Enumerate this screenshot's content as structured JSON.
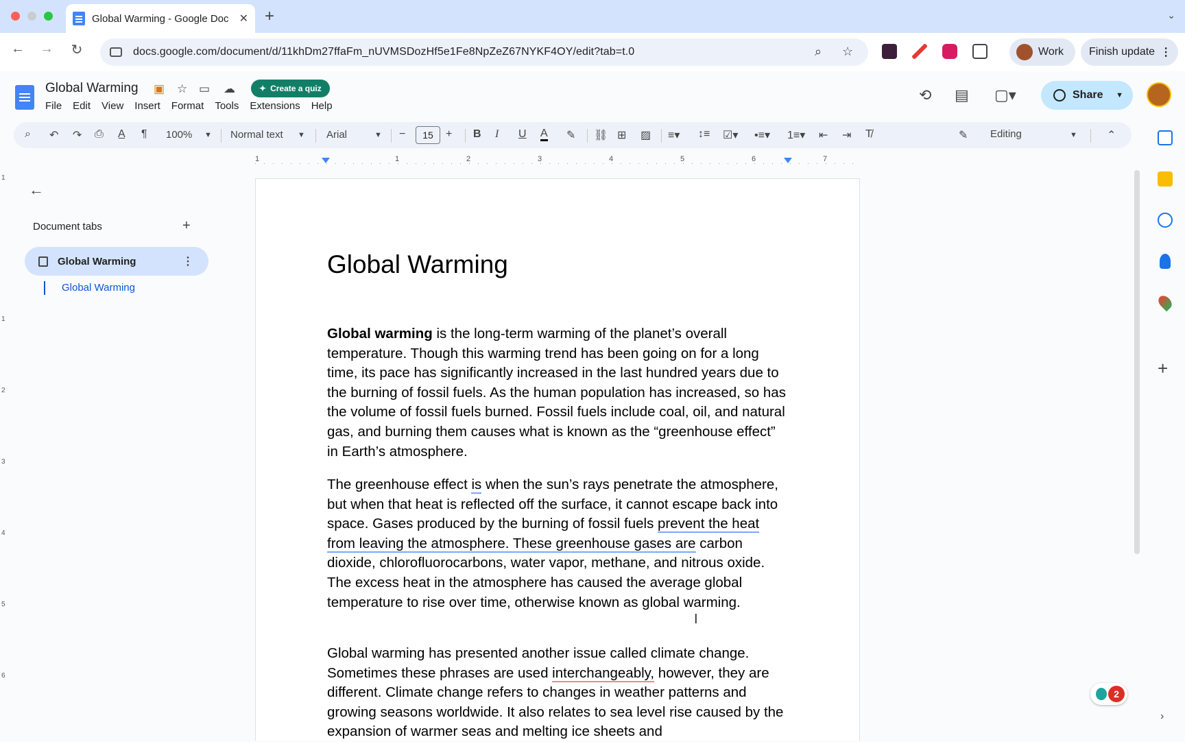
{
  "browser": {
    "tab_title": "Global Warming - Google Doc",
    "new_tab_label": "+",
    "url": "docs.google.com/document/d/11khDm27ffaFm_nUVMSDozHf5e1Fe8NpZeZ67NYKF4OY/edit?tab=t.0",
    "profile_label": "Work",
    "finish_update_label": "Finish update"
  },
  "docs_header": {
    "title": "Global Warming",
    "create_quiz_label": "Create a quiz",
    "menus": [
      "File",
      "Edit",
      "View",
      "Insert",
      "Format",
      "Tools",
      "Extensions",
      "Help"
    ],
    "share_label": "Share"
  },
  "format_toolbar": {
    "zoom": "100%",
    "style": "Normal text",
    "font": "Arial",
    "font_size": "15",
    "mode": "Editing"
  },
  "ruler": {
    "h_numbers": [
      "1",
      "1",
      "2",
      "3",
      "4",
      "5",
      "6",
      "7"
    ],
    "v_numbers": [
      "1",
      "1",
      "2",
      "3",
      "4",
      "5",
      "6"
    ]
  },
  "sidebar": {
    "heading": "Document tabs",
    "tab_label": "Global Warming",
    "outline_item": "Global Warming"
  },
  "document": {
    "heading": "Global Warming",
    "p1_bold": "Global warming",
    "p1_rest": " is the long-term warming of the planet’s overall temperature. Though this warming trend has been going on for a long time, its pace has significantly increased in the last hundred years due to the burning of fossil fuels. As the human population has increased, so has the volume of fossil fuels burned. Fossil fuels include coal, oil, and natural gas, and burning them causes what is known as the “greenhouse effect” in Earth’s atmosphere.",
    "p2_a": "The greenhouse effect ",
    "p2_is": "is",
    "p2_b": " when the sun’s rays penetrate the atmosphere, but when that heat is reflected off the surface, it cannot escape back into space. Gases produced by the burning of fossil fuels ",
    "p2_underlined": "prevent the heat from leaving the atmosphere. These greenhouse gases are",
    "p2_c": " carbon dioxide, chlorofluorocarbons, water vapor, methane, and nitrous oxide. The excess heat in the atmosphere has caused the average global temperature to rise over time, otherwise known as global warming.",
    "p3_a": "Global warming has presented another issue called climate change. Sometimes these phrases are used ",
    "p3_misspelled": "interchangeably,",
    "p3_b": " however, they are different. Climate change refers to changes in weather patterns and growing seasons worldwide. It also relates to sea level rise caused by the expansion of warmer seas and melting ice sheets and"
  },
  "assistant": {
    "count": "2"
  },
  "colors": {
    "accent": "#0b57d0",
    "share_bg": "#c2e7ff",
    "quiz_bg": "#137e67",
    "tab_selected_bg": "#d3e3fd"
  }
}
